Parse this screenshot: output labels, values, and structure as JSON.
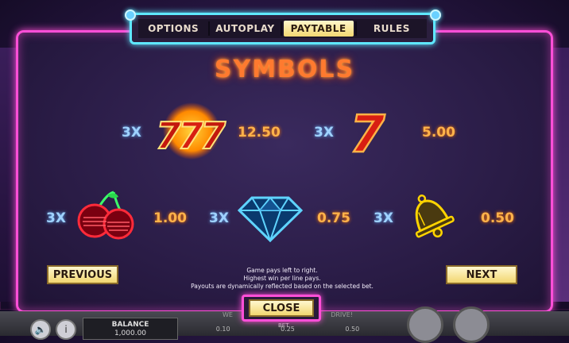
{
  "tabs": [
    {
      "label": "OPTIONS",
      "active": false
    },
    {
      "label": "AUTOPLAY",
      "active": false
    },
    {
      "label": "PAYTABLE",
      "active": true
    },
    {
      "label": "RULES",
      "active": false
    }
  ],
  "title": "SYMBOLS",
  "symbols": [
    {
      "icon": "triple-seven-icon",
      "multiplier": "3X",
      "payout": "12.50"
    },
    {
      "icon": "seven-icon",
      "multiplier": "3X",
      "payout": "5.00"
    },
    {
      "icon": "cherry-icon",
      "multiplier": "3X",
      "payout": "1.00"
    },
    {
      "icon": "diamond-icon",
      "multiplier": "3X",
      "payout": "0.75"
    },
    {
      "icon": "bell-icon",
      "multiplier": "3X",
      "payout": "0.50"
    }
  ],
  "nav": {
    "previous": "PREVIOUS",
    "next": "NEXT",
    "close": "CLOSE"
  },
  "notes": [
    "Game pays left to right.",
    "Highest win per line pays.",
    "Payouts are dynamically reflected based on the selected bet."
  ],
  "footer": {
    "balance_label": "BALANCE",
    "balance_value": "1,000.00",
    "ticker_left": "WE",
    "ticker_right": "DRIVE!",
    "bet_label": "BET",
    "bet_values": [
      "0.10",
      "0.25",
      "0.50"
    ]
  },
  "colors": {
    "panel_border": "#ff4fd8",
    "tab_border": "#5fe8ff",
    "button_fill": "#f2d670",
    "payout_text": "#ffb24a",
    "multiplier_text": "#9fd2ff"
  }
}
